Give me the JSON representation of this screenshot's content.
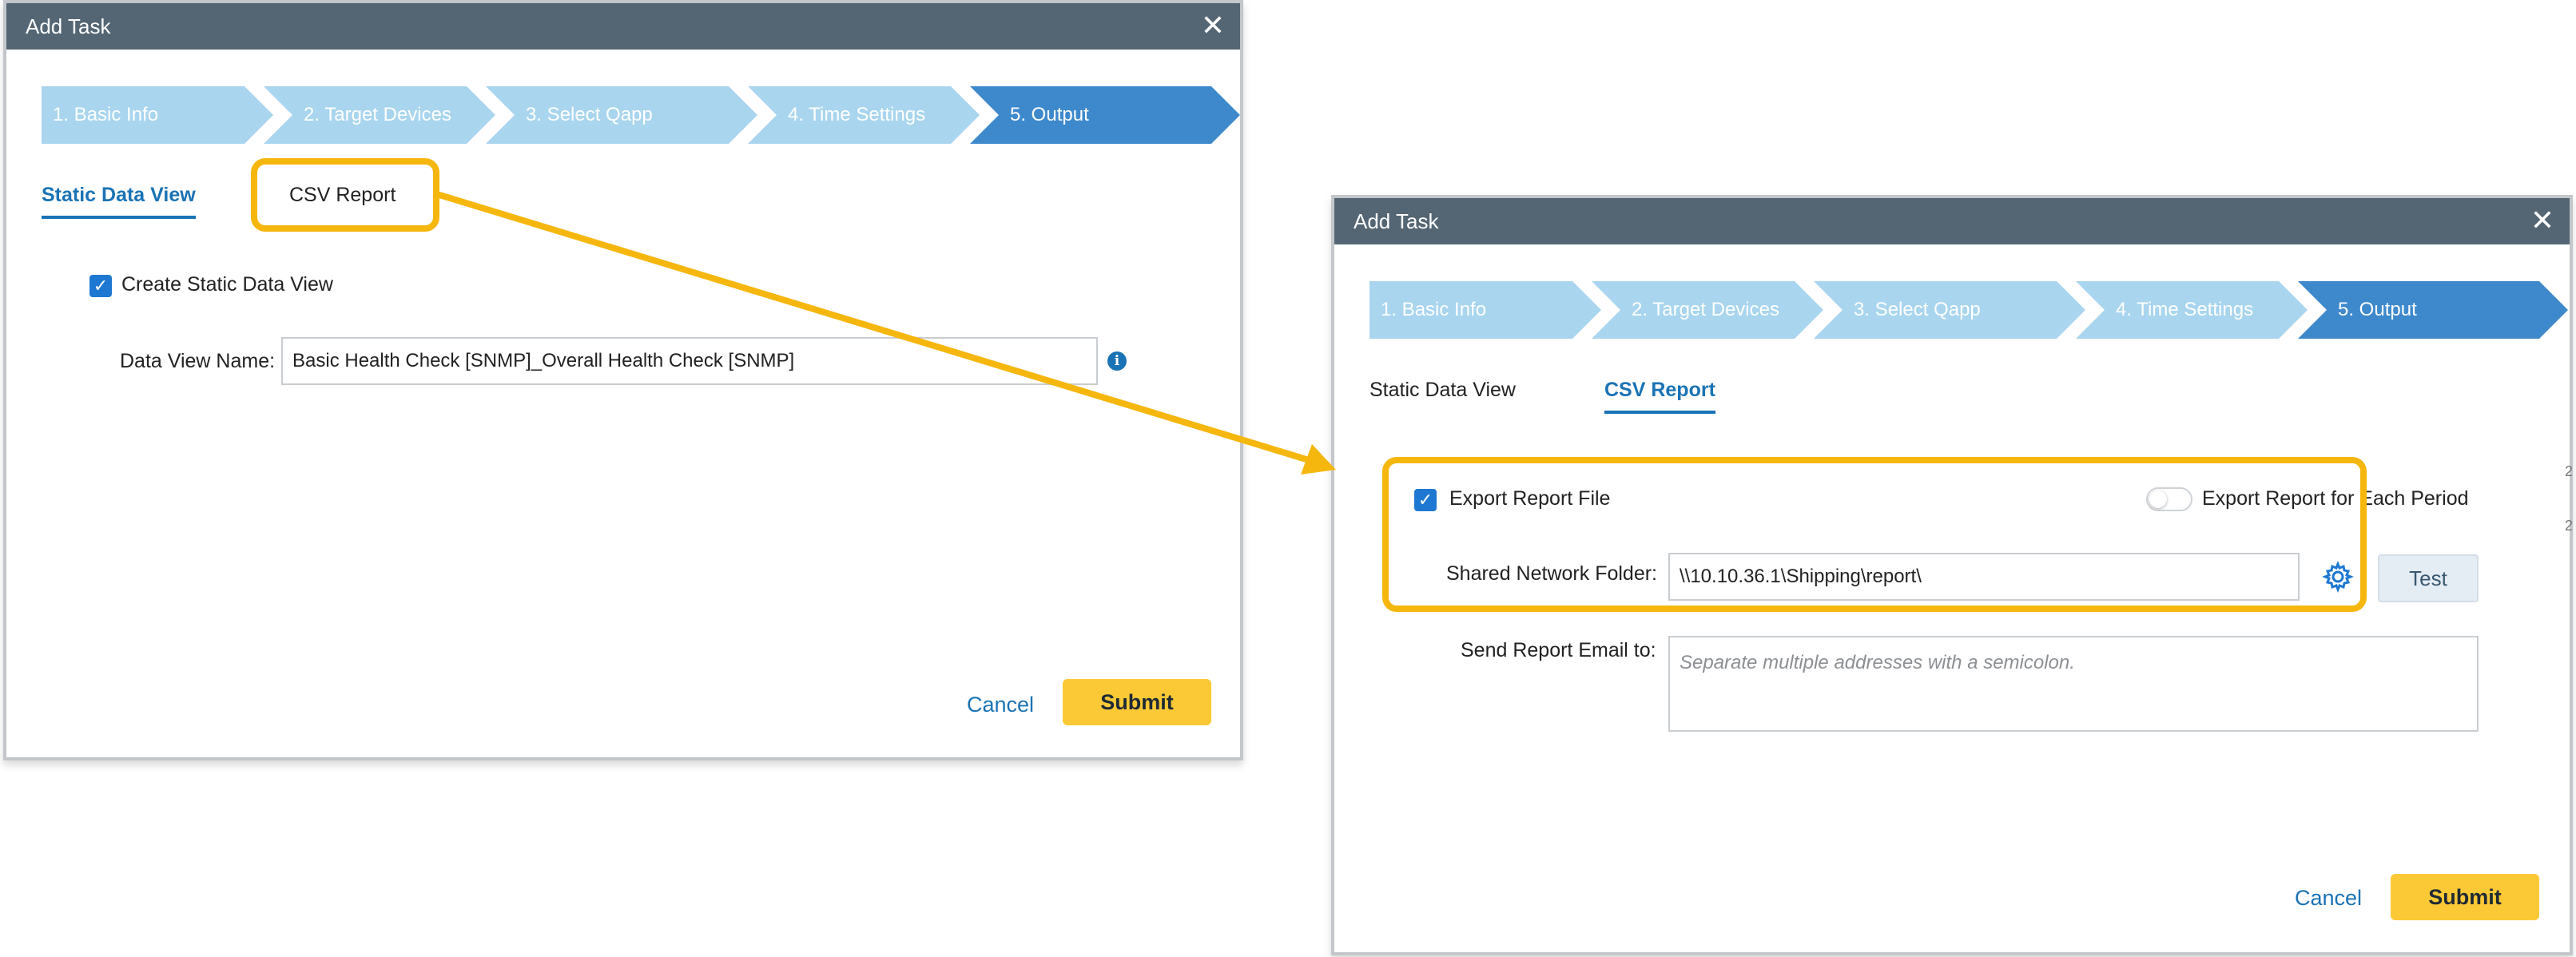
{
  "left_dialog": {
    "title": "Add Task",
    "steps": [
      "1. Basic Info",
      "2. Target Devices",
      "3. Select Qapp",
      "4. Time Settings",
      "5. Output"
    ],
    "tabs": {
      "static": "Static Data View",
      "csv": "CSV Report"
    },
    "create_static_label": "Create Static Data View",
    "data_view_name_label": "Data View Name:",
    "data_view_name_value": "Basic Health Check [SNMP]_Overall Health Check [SNMP]",
    "cancel": "Cancel",
    "submit": "Submit"
  },
  "right_dialog": {
    "title": "Add Task",
    "steps": [
      "1. Basic Info",
      "2. Target Devices",
      "3. Select Qapp",
      "4. Time Settings",
      "5. Output"
    ],
    "tabs": {
      "static": "Static Data View",
      "csv": "CSV Report"
    },
    "export_file_label": "Export Report File",
    "export_each_period_label": "Export Report for Each Period",
    "shared_folder_label": "Shared Network Folder:",
    "shared_folder_value": "\\\\10.10.36.1\\Shipping\\report\\",
    "test_button": "Test",
    "email_label": "Send Report Email to:",
    "email_placeholder": "Separate multiple addresses with a semicolon.",
    "cancel": "Cancel",
    "submit": "Submit"
  },
  "icons": {
    "close": "close-icon",
    "check": "checkmark-icon",
    "info": "info-icon",
    "gear": "gear-icon"
  },
  "colors": {
    "titlebar": "#546673",
    "step_inactive": "#a9d5ee",
    "step_active": "#3e89cc",
    "tab_active": "#1a73b5",
    "submit": "#fcc936",
    "highlight": "#f5b70e"
  }
}
